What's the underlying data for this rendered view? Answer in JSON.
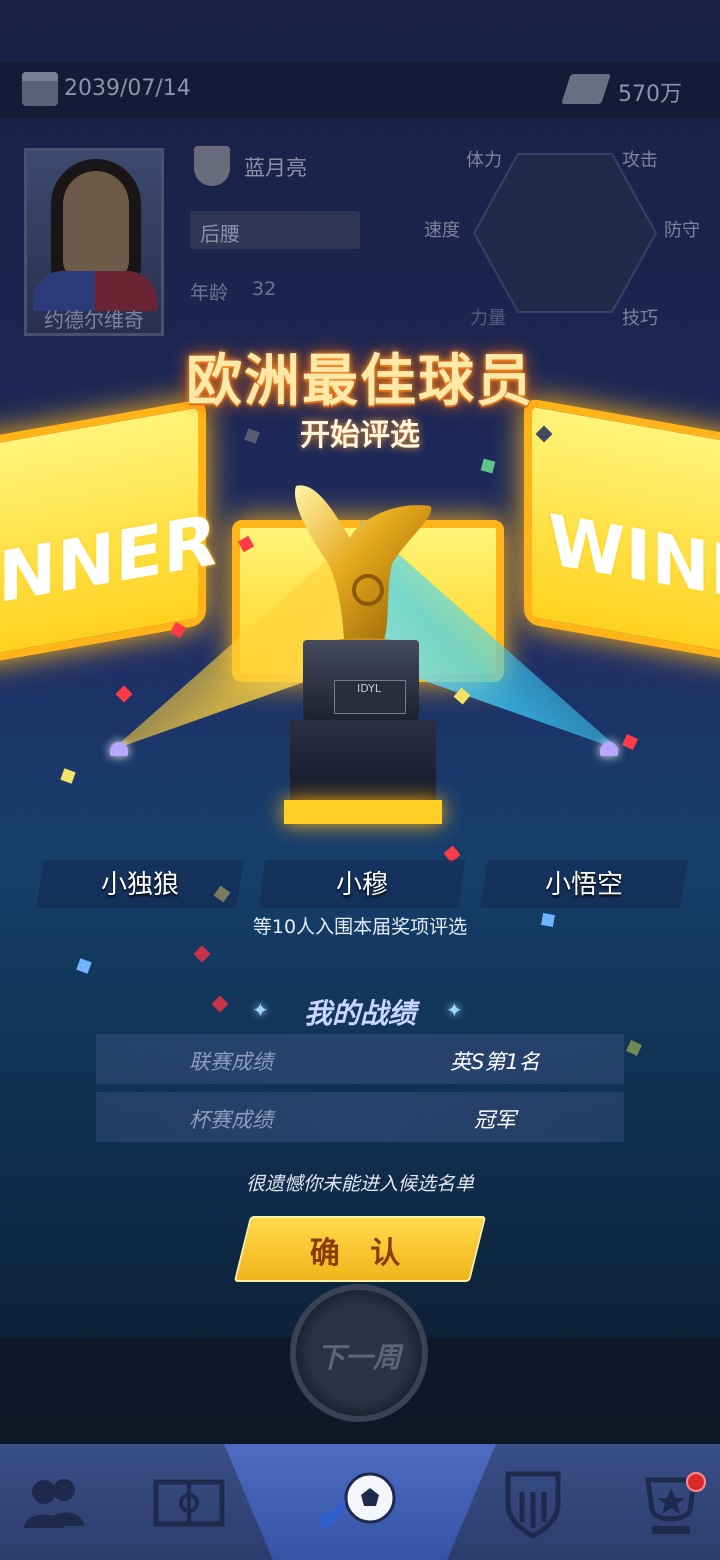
{
  "header": {
    "date": "2039/07/14",
    "money": "570万",
    "calendar_icon": "calendar-icon",
    "money_icon": "cash-icon"
  },
  "player": {
    "name": "约德尔维奇",
    "club": "蓝月亮",
    "position": "后腰",
    "age_label": "年龄",
    "age": "32",
    "stats": {
      "stamina": "体力",
      "attack": "攻击",
      "speed": "速度",
      "defense": "防守",
      "technique": "技巧",
      "strength": "力量"
    }
  },
  "event": {
    "title": "欧洲最佳球员",
    "subtitle": "开始评选",
    "screen_text_left": "NNER",
    "screen_text_right": "WINN",
    "plaque": "IDYL"
  },
  "nominees": {
    "list": [
      "小独狼",
      "小穆",
      "小悟空"
    ],
    "note": "等10人入围本届奖项评选"
  },
  "record": {
    "title": "我的战绩",
    "rows": [
      {
        "label": "联赛成绩",
        "value": "英S第1名"
      },
      {
        "label": "杯赛成绩",
        "value": "冠军"
      }
    ],
    "result_msg": "很遗憾你未能进入候选名单"
  },
  "buttons": {
    "confirm": "确 认",
    "next_week": "下一周"
  },
  "nav": {
    "items": [
      "team-icon",
      "pitch-icon",
      "match-icon",
      "club-badge-icon",
      "trophy-icon"
    ],
    "active_index": 2
  },
  "colors": {
    "accent_gold": "#ffd21f",
    "beam_blue": "#3cd2ff",
    "title_glow": "#ff9a2e"
  }
}
